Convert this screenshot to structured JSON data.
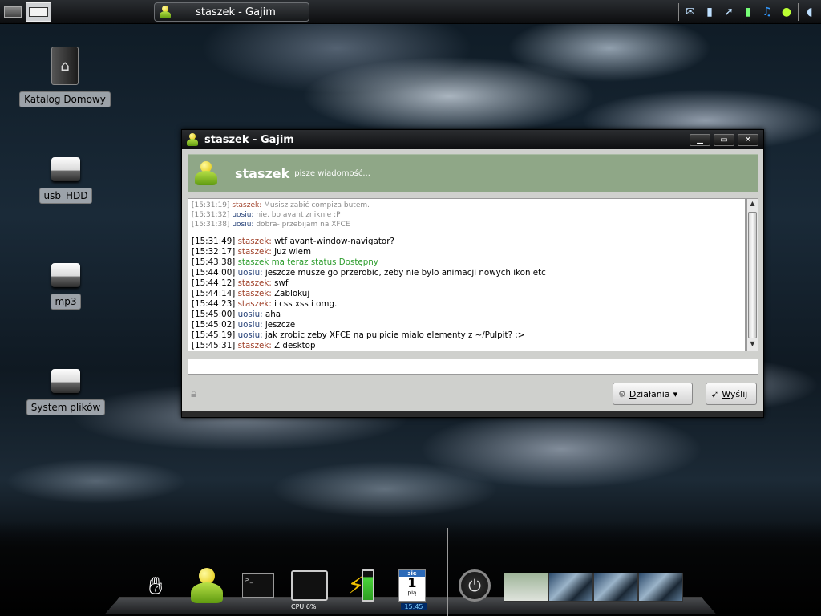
{
  "top_panel": {
    "active_task": "staszek - Gajim",
    "tray_icons": [
      "network-icon",
      "signal-icon",
      "cursor-icon",
      "battery-icon",
      "music-icon",
      "gajim-icon",
      "volume-icon"
    ]
  },
  "desktop": {
    "icons": [
      {
        "label": "Katalog Domowy",
        "icon": "home-folder-icon"
      },
      {
        "label": "usb_HDD",
        "icon": "drive-icon"
      },
      {
        "label": "mp3",
        "icon": "drive-icon"
      },
      {
        "label": "System plików",
        "icon": "drive-icon"
      }
    ]
  },
  "window": {
    "title": "staszek - Gajim",
    "contact_name": "staszek",
    "contact_status": "pisze wiadomość...",
    "history": [
      {
        "time": "[15:31:19]",
        "nick": "staszek:",
        "kind": "s",
        "text": "Musisz zabić compiza butem."
      },
      {
        "time": "[15:31:32]",
        "nick": "uosiu:",
        "kind": "u",
        "text": "nie, bo avant zniknie :P"
      },
      {
        "time": "[15:31:38]",
        "nick": "uosiu:",
        "kind": "u",
        "text": "dobra- przebijam na XFCE"
      }
    ],
    "messages": [
      {
        "time": "[15:31:49]",
        "nick": "staszek:",
        "kind": "s",
        "text": "wtf avant-window-navigator?"
      },
      {
        "time": "[15:32:17]",
        "nick": "staszek:",
        "kind": "s",
        "text": "Juz wiem"
      },
      {
        "time": "[15:43:38]",
        "nick": "",
        "kind": "status",
        "text": "staszek ma teraz status Dostępny"
      },
      {
        "time": "[15:44:00]",
        "nick": "uosiu:",
        "kind": "u",
        "text": "jeszcze musze go przerobic, zeby nie bylo animacji nowych ikon etc"
      },
      {
        "time": "[15:44:12]",
        "nick": "staszek:",
        "kind": "s",
        "text": "swf"
      },
      {
        "time": "[15:44:14]",
        "nick": "staszek:",
        "kind": "s",
        "text": "Zablokuj"
      },
      {
        "time": "[15:44:23]",
        "nick": "staszek:",
        "kind": "s",
        "text": "i css xss i omg."
      },
      {
        "time": "[15:45:00]",
        "nick": "uosiu:",
        "kind": "u",
        "text": "aha"
      },
      {
        "time": "[15:45:02]",
        "nick": "uosiu:",
        "kind": "u",
        "text": "jeszcze"
      },
      {
        "time": "[15:45:19]",
        "nick": "uosiu:",
        "kind": "u",
        "text": "jak zrobic zeby XFCE na pulpicie mialo elementy z ~/Pulpit? :>"
      },
      {
        "time": "[15:45:31]",
        "nick": "staszek:",
        "kind": "s",
        "text": "Z desktop"
      }
    ],
    "input_value": "",
    "actions_label_prefix": "D",
    "actions_label_rest": "ziałania",
    "send_label_prefix": "W",
    "send_label_rest": "yślij"
  },
  "dock": {
    "cpu_label": "CPU 6%",
    "calendar_month": "sie",
    "calendar_day": "1",
    "calendar_weekday": "pią",
    "clock": "15:45"
  },
  "colors": {
    "nick_staszek": "#a0422b",
    "nick_uosiu": "#29447a",
    "status": "#2f9e2f",
    "banner": "#8fa787"
  }
}
